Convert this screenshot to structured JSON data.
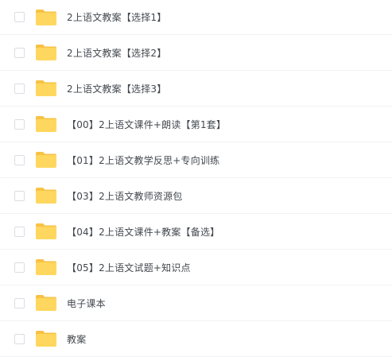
{
  "file_list": {
    "items": [
      {
        "name": "2上语文教案【选择1】",
        "icon": "folder-icon"
      },
      {
        "name": "2上语文教案【选择2】",
        "icon": "folder-icon"
      },
      {
        "name": "2上语文教案【选择3】",
        "icon": "folder-icon"
      },
      {
        "name": "【00】2上语文课件+朗读【第1套】",
        "icon": "folder-icon"
      },
      {
        "name": "【01】2上语文教学反思+专向训练",
        "icon": "folder-icon"
      },
      {
        "name": "【03】2上语文教师资源包",
        "icon": "folder-icon"
      },
      {
        "name": "【04】2上语文课件+教案【备选】",
        "icon": "folder-icon"
      },
      {
        "name": "【05】2上语文试题+知识点",
        "icon": "folder-icon"
      },
      {
        "name": "电子课本",
        "icon": "folder-icon"
      },
      {
        "name": "教案",
        "icon": "folder-icon"
      }
    ]
  },
  "colors": {
    "folder_body": "#ffd75e",
    "folder_tab": "#f7c244",
    "text": "#43484f",
    "divider": "#f1f2f4",
    "checkbox_border": "#d9dde3"
  }
}
